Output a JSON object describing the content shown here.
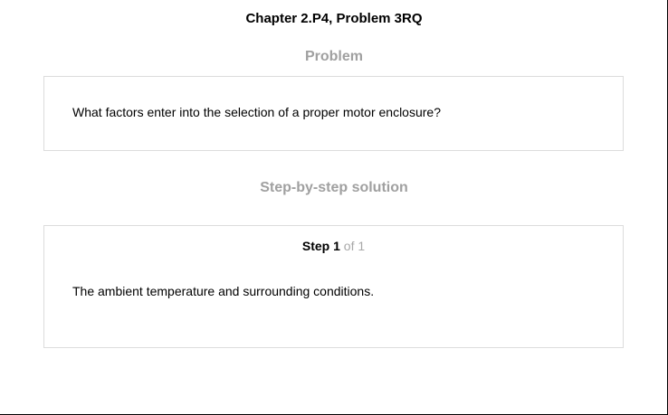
{
  "header": {
    "title": "Chapter 2.P4, Problem 3RQ"
  },
  "problem": {
    "heading": "Problem",
    "text": "What factors enter into the selection of a proper motor enclosure?"
  },
  "solution": {
    "heading": "Step-by-step solution",
    "step": {
      "word": "Step",
      "number": "1",
      "of_text": "of 1"
    },
    "text": "The ambient temperature and surrounding conditions."
  }
}
